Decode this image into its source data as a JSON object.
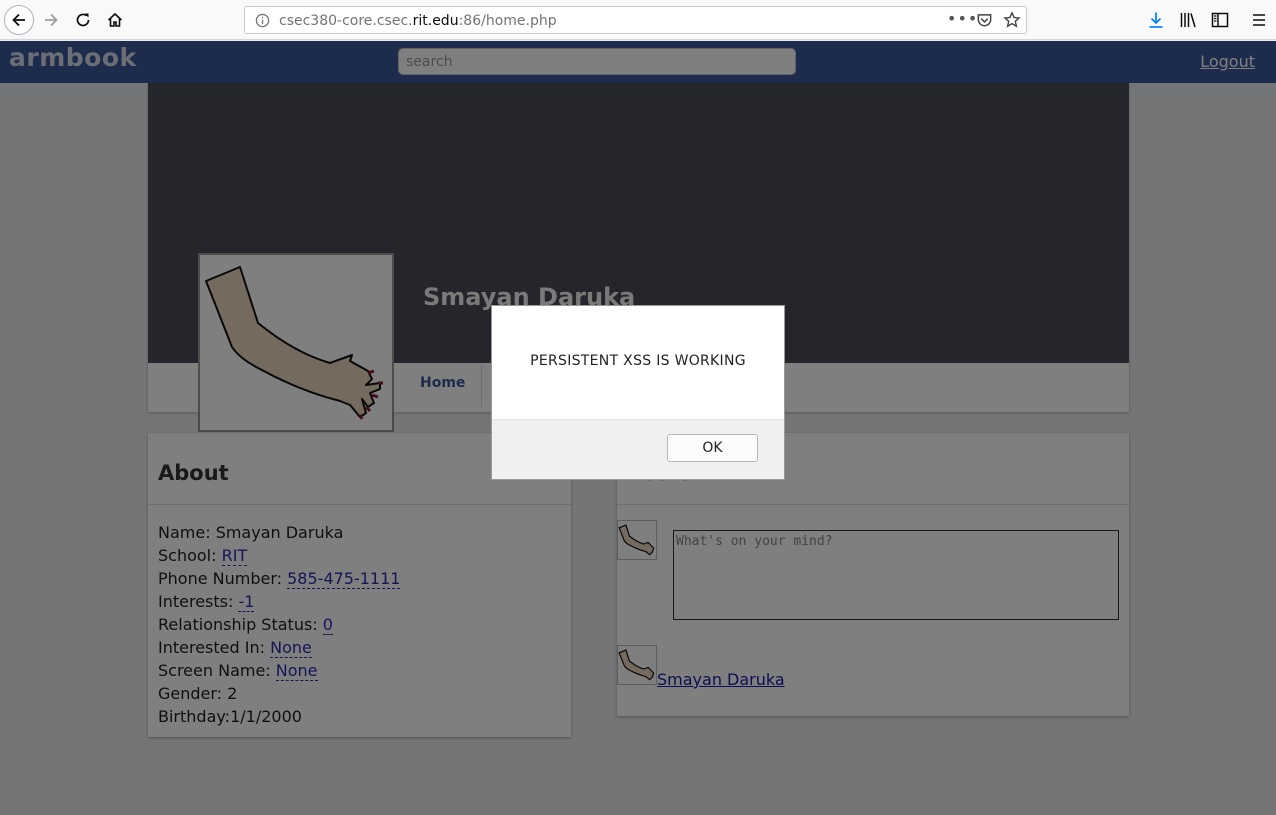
{
  "browser": {
    "url_prefix": "csec380-core.csec.",
    "url_domain": "rit.edu",
    "url_suffix": ":86/home.php"
  },
  "header": {
    "logo": "armbook",
    "search_placeholder": "search",
    "logout_label": "Logout",
    "color": "#3b5998"
  },
  "profile": {
    "name": "Smayan Daruka",
    "nav_home": "Home"
  },
  "about": {
    "title": "About",
    "name_label": "Name:",
    "name_value": "Smayan Daruka",
    "school_label": "School:",
    "school_value": "RIT",
    "phone_label": "Phone Number:",
    "phone_value": "585-475-1111",
    "interests_label": "Interests:",
    "interests_value": "-1",
    "relationship_label": "Relationship Status:",
    "relationship_value": "0",
    "interested_label": "Interested In:",
    "interested_value": "None",
    "screen_label": "Screen Name:",
    "screen_value": "None",
    "gender_label": "Gender:",
    "gender_value": "2",
    "birthday_label": "Birthday:",
    "birthday_value": "1/1/2000"
  },
  "posts": {
    "title": "Posts",
    "placeholder": "What's on your mind?",
    "author": "Smayan Daruka"
  },
  "dialog": {
    "message": "PERSISTENT XSS IS WORKING",
    "ok_label": "OK"
  }
}
